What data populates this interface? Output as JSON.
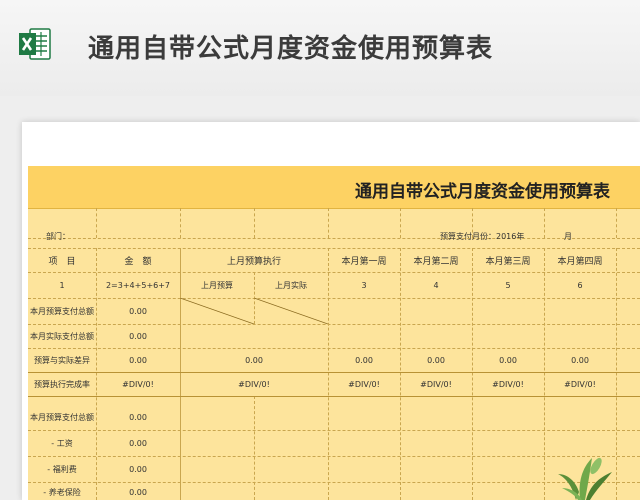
{
  "page": {
    "title": "通用自带公式月度资金使用预算表"
  },
  "sheet": {
    "title": "通用自带公式月度资金使用预算表",
    "dept_label": "部门：",
    "month_label": "预算支付月份：2016年",
    "month_unit": "月",
    "headers": {
      "item": "项　目",
      "amount": "金　额",
      "last_month": "上月预算执行",
      "week1": "本月第一周",
      "week2": "本月第二周",
      "week3": "本月第三周",
      "week4": "本月第四周"
    },
    "index_row": {
      "item": "1",
      "amount": "2=3+4+5+6+7",
      "last_budget": "上月预算",
      "last_actual": "上月实际",
      "w1": "3",
      "w2": "4",
      "w3": "5",
      "w4": "6"
    },
    "rows": [
      {
        "label": "本月预算支付总额",
        "amount": "0.00"
      },
      {
        "label": "本月实际支付总额",
        "amount": "0.00"
      },
      {
        "label": "预算与实际差异",
        "amount": "0.00",
        "last": "0.00",
        "w1": "0.00",
        "w2": "0.00",
        "w3": "0.00",
        "w4": "0.00"
      },
      {
        "label": "预算执行完成率",
        "amount": "#DIV/0!",
        "last": "#DIV/0!",
        "w1": "#DIV/0!",
        "w2": "#DIV/0!",
        "w3": "#DIV/0!",
        "w4": "#DIV/0!"
      }
    ],
    "rows2": [
      {
        "label": "本月预算支付总额",
        "amount": "0.00"
      },
      {
        "label": "- 工资",
        "amount": "0.00"
      },
      {
        "label": "- 福利费",
        "amount": "0.00"
      },
      {
        "label": "- 养老保险",
        "amount": "0.00"
      }
    ]
  },
  "colors": {
    "band": "#fdd263",
    "sheet": "#fde49c",
    "excel_green": "#1f7a44"
  },
  "icons": {
    "app": "excel-icon",
    "decor": "plant-icon"
  }
}
